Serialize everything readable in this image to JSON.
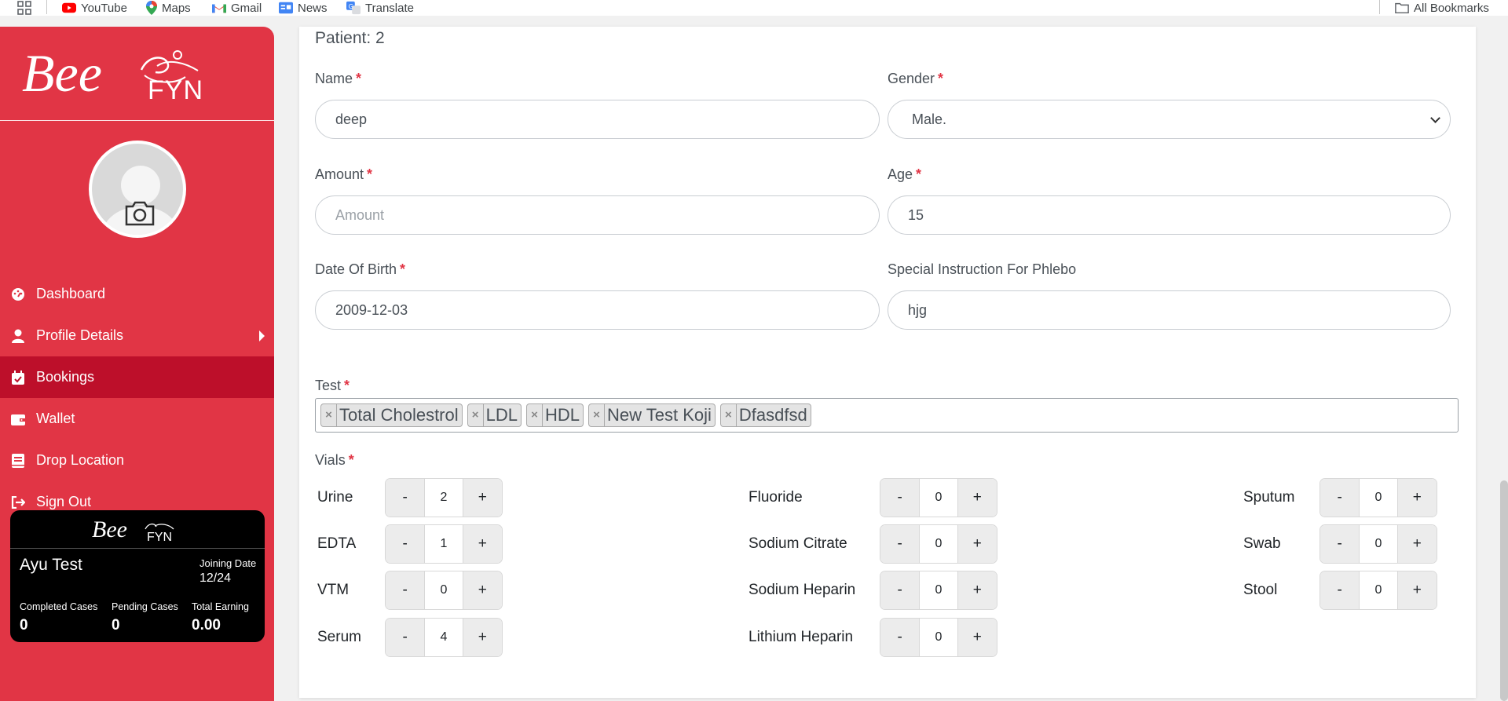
{
  "bookmarks": {
    "items": [
      {
        "label": "YouTube",
        "icon": "youtube-icon"
      },
      {
        "label": "Maps",
        "icon": "maps-icon"
      },
      {
        "label": "Gmail",
        "icon": "gmail-icon"
      },
      {
        "label": "News",
        "icon": "news-icon"
      },
      {
        "label": "Translate",
        "icon": "translate-icon"
      }
    ],
    "all_bookmarks": "All Bookmarks"
  },
  "sidebar": {
    "logo": {
      "script": "Bee",
      "word": "FYN"
    },
    "nav": [
      {
        "label": "Dashboard",
        "icon": "dashboard-icon"
      },
      {
        "label": "Profile Details",
        "icon": "user-icon"
      },
      {
        "label": "Bookings",
        "icon": "calendar-icon",
        "active": true
      },
      {
        "label": "Wallet",
        "icon": "wallet-icon"
      },
      {
        "label": "Drop Location",
        "icon": "book-icon"
      },
      {
        "label": "Sign Out",
        "icon": "sign-out-icon"
      }
    ],
    "card": {
      "logo_script": "Bee",
      "logo_word": "FYN",
      "name": "Ayu Test",
      "joining_date_label": "Joining Date",
      "joining_date": "12/24",
      "stats": [
        {
          "label": "Completed Cases",
          "value": "0"
        },
        {
          "label": "Pending Cases",
          "value": "0"
        },
        {
          "label": "Total Earning",
          "value": "0.00"
        }
      ]
    }
  },
  "form": {
    "patient_title": "Patient: 2",
    "name": {
      "label": "Name",
      "value": "deep"
    },
    "gender": {
      "label": "Gender",
      "value": "Male."
    },
    "amount": {
      "label": "Amount",
      "placeholder": "Amount",
      "value": ""
    },
    "age": {
      "label": "Age",
      "value": "15"
    },
    "dob": {
      "label": "Date Of Birth",
      "value": "2009-12-03"
    },
    "special": {
      "label": "Special Instruction For Phlebo",
      "value": "hjg"
    },
    "test": {
      "label": "Test",
      "chips": [
        "Total Cholestrol",
        "LDL",
        "HDL",
        "New Test Koji",
        "Dfasdfsd"
      ]
    },
    "vials": {
      "label": "Vials",
      "minus": "-",
      "plus": "+",
      "col1": [
        {
          "name": "Urine",
          "value": "2"
        },
        {
          "name": "EDTA",
          "value": "1"
        },
        {
          "name": "VTM",
          "value": "0"
        },
        {
          "name": "Serum",
          "value": "4"
        }
      ],
      "col2": [
        {
          "name": "Fluoride",
          "value": "0"
        },
        {
          "name": "Sodium Citrate",
          "value": "0"
        },
        {
          "name": "Sodium Heparin",
          "value": "0"
        },
        {
          "name": "Lithium Heparin",
          "value": "0"
        }
      ],
      "col3": [
        {
          "name": "Sputum",
          "value": "0"
        },
        {
          "name": "Swab",
          "value": "0"
        },
        {
          "name": "Stool",
          "value": "0"
        }
      ]
    }
  },
  "required_mark": "*"
}
